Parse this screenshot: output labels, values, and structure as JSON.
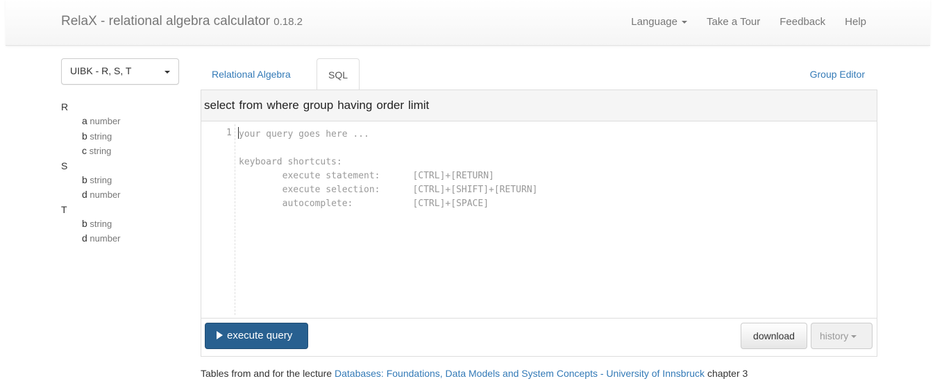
{
  "app": {
    "title": "RelaX - relational algebra calculator",
    "version": "0.18.2"
  },
  "nav": {
    "language": "Language",
    "tour": "Take a Tour",
    "feedback": "Feedback",
    "help": "Help"
  },
  "dataset": {
    "selected": "UIBK - R, S, T"
  },
  "schema": [
    {
      "name": "R",
      "attrs": [
        {
          "name": "a",
          "type": "number"
        },
        {
          "name": "b",
          "type": "string"
        },
        {
          "name": "c",
          "type": "string"
        }
      ]
    },
    {
      "name": "S",
      "attrs": [
        {
          "name": "b",
          "type": "string"
        },
        {
          "name": "d",
          "type": "number"
        }
      ]
    },
    {
      "name": "T",
      "attrs": [
        {
          "name": "b",
          "type": "string"
        },
        {
          "name": "d",
          "type": "number"
        }
      ]
    }
  ],
  "tabs": {
    "relational_algebra": "Relational Algebra",
    "sql": "SQL",
    "group_editor": "Group Editor"
  },
  "keywords": [
    "select",
    "from",
    "where",
    "group",
    "having",
    "order",
    "limit"
  ],
  "editor": {
    "line_number": "1",
    "placeholder": "your query goes here ...\n\nkeyboard shortcuts:\n\texecute statement:\t[CTRL]+[RETURN]\n\texecute selection:\t[CTRL]+[SHIFT]+[RETURN]\n\tautocomplete:\t\t[CTRL]+[SPACE]"
  },
  "buttons": {
    "execute": "execute query",
    "download": "download",
    "history": "history"
  },
  "footer": {
    "prefix": "Tables from and for the lecture",
    "link": "Databases: Foundations, Data Models and System Concepts - University of Innsbruck",
    "suffix": "chapter 3"
  },
  "colors": {
    "primary": "#286090",
    "link": "#337ab7"
  }
}
